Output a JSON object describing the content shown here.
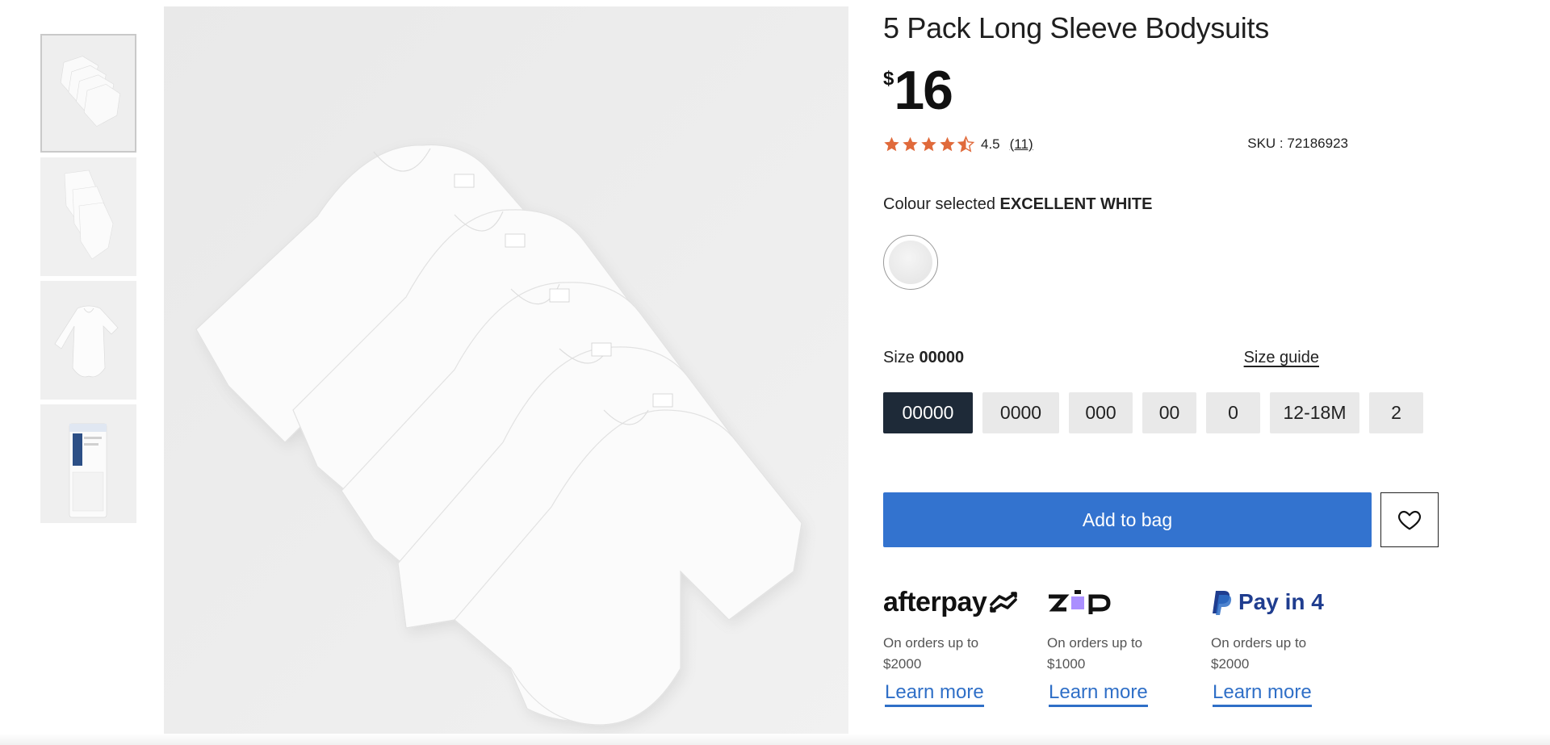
{
  "product": {
    "title": "5 Pack Long Sleeve Bodysuits",
    "currency_symbol": "$",
    "price": "16",
    "rating_value": "4.5",
    "review_count": "(11)",
    "rating_stars": 4.5,
    "sku_label": "SKU : 72186923"
  },
  "colour": {
    "label": "Colour selected",
    "value": "EXCELLENT WHITE"
  },
  "size": {
    "label": "Size",
    "selected": "00000",
    "guide_label": "Size guide",
    "options": [
      "00000",
      "0000",
      "000",
      "00",
      "0",
      "12-18M",
      "2"
    ]
  },
  "actions": {
    "add_to_bag": "Add to bag"
  },
  "payments": [
    {
      "brand": "afterpay",
      "note_line1": "On orders up to",
      "note_line2": "$2000",
      "learn": "Learn more"
    },
    {
      "brand": "zip",
      "note_line1": "On orders up to",
      "note_line2": "$1000",
      "learn": "Learn more"
    },
    {
      "brand": "Pay in 4",
      "note_line1": "On orders up to",
      "note_line2": "$2000",
      "learn": "Learn more"
    }
  ],
  "colors": {
    "accent_blue": "#3373cf",
    "selected_size_bg": "#1e2a38",
    "star": "#e06a3b",
    "link_blue": "#2f6fc7",
    "zip_purple": "#aa8fff",
    "paypal_navy": "#1f3d8f"
  },
  "icons": {
    "star": "star-icon",
    "heart": "heart-icon",
    "paypal": "paypal-logo-icon",
    "afterpay": "afterpay-arrows-icon"
  }
}
